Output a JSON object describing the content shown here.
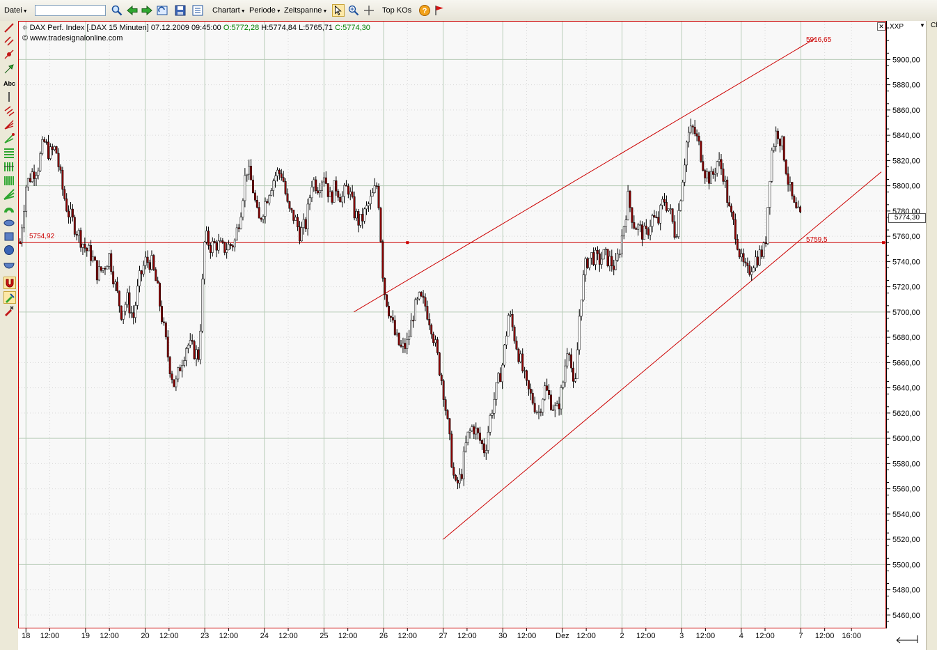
{
  "toolbar": {
    "file_menu": "Datei",
    "symbol_value": "",
    "chart_type_menu": "Chartart",
    "period_menu": "Periode",
    "timespan_menu": "Zeitspanne",
    "top_kos": "Top KOs"
  },
  "chart_header": {
    "title": "DAX Perf. Index [.DAX  15 Minuten]",
    "datetime": "07.12.2009 09:45:00",
    "open": "O:5772,28",
    "high": "H:5774,84",
    "low": "L:5765,71",
    "close": "C:5774,30",
    "copyright": "© www.tradesignalonline.com"
  },
  "axis_header": "XXP",
  "right_strip_label": "Ch",
  "price_labels": {
    "current": "5774,30",
    "hline_left": "5754,92",
    "hline_right": "5759,5",
    "trend_top": "5916,65"
  },
  "colors": {
    "accent": "#cc0000",
    "candle_down": "#8b0000",
    "open_text": "#008000",
    "grid": "#c8d8c8"
  },
  "chart_data": {
    "type": "candlestick",
    "ylim": [
      5450,
      5930
    ],
    "y_ticks": [
      5460,
      5480,
      5500,
      5520,
      5540,
      5560,
      5580,
      5600,
      5620,
      5640,
      5660,
      5680,
      5700,
      5720,
      5740,
      5760,
      5780,
      5800,
      5820,
      5840,
      5860,
      5880,
      5900
    ],
    "y_tick_labels": [
      "5460,00",
      "5480,00",
      "5500,00",
      "5520,00",
      "5540,00",
      "5560,00",
      "5580,00",
      "5600,00",
      "5620,00",
      "5640,00",
      "5660,00",
      "5680,00",
      "5700,00",
      "5720,00",
      "5740,00",
      "5760,00",
      "5780,00",
      "5800,00",
      "5820,00",
      "5840,00",
      "5860,00",
      "5880,00",
      "5900,00"
    ],
    "x_tick_labels": [
      {
        "label": "18",
        "x": 0
      },
      {
        "label": "12:00",
        "x": 4
      },
      {
        "label": "19",
        "x": 10
      },
      {
        "label": "12:00",
        "x": 14
      },
      {
        "label": "20",
        "x": 20
      },
      {
        "label": "12:00",
        "x": 24
      },
      {
        "label": "23",
        "x": 30
      },
      {
        "label": "12:00",
        "x": 34
      },
      {
        "label": "24",
        "x": 40
      },
      {
        "label": "12:00",
        "x": 44
      },
      {
        "label": "25",
        "x": 50
      },
      {
        "label": "12:00",
        "x": 54
      },
      {
        "label": "26",
        "x": 60
      },
      {
        "label": "12:00",
        "x": 64
      },
      {
        "label": "27",
        "x": 70
      },
      {
        "label": "12:00",
        "x": 74
      },
      {
        "label": "30",
        "x": 80
      },
      {
        "label": "12:00",
        "x": 84
      },
      {
        "label": "Dez",
        "x": 90
      },
      {
        "label": "12:00",
        "x": 94
      },
      {
        "label": "2",
        "x": 100
      },
      {
        "label": "12:00",
        "x": 104
      },
      {
        "label": "3",
        "x": 110
      },
      {
        "label": "12:00",
        "x": 114
      },
      {
        "label": "4",
        "x": 120
      },
      {
        "label": "12:00",
        "x": 124
      },
      {
        "label": "7",
        "x": 130
      },
      {
        "label": "12:00",
        "x": 134
      },
      {
        "label": "16:00",
        "x": 138.5
      }
    ],
    "xlim": [
      -1.2,
      144.2
    ],
    "price_path": [
      [
        -1,
        5755
      ],
      [
        0,
        5800
      ],
      [
        1,
        5810
      ],
      [
        2,
        5815
      ],
      [
        3,
        5835
      ],
      [
        4,
        5825
      ],
      [
        5,
        5830
      ],
      [
        6,
        5800
      ],
      [
        7,
        5780
      ],
      [
        8,
        5770
      ],
      [
        9,
        5760
      ],
      [
        10,
        5750
      ],
      [
        11,
        5745
      ],
      [
        12,
        5730
      ],
      [
        13,
        5735
      ],
      [
        14,
        5745
      ],
      [
        15,
        5720
      ],
      [
        16,
        5700
      ],
      [
        17,
        5710
      ],
      [
        18,
        5695
      ],
      [
        19,
        5725
      ],
      [
        20,
        5740
      ],
      [
        21,
        5740
      ],
      [
        22,
        5720
      ],
      [
        23,
        5690
      ],
      [
        24,
        5660
      ],
      [
        25,
        5640
      ],
      [
        26,
        5660
      ],
      [
        27,
        5675
      ],
      [
        28,
        5670
      ],
      [
        29,
        5665
      ],
      [
        30,
        5760
      ],
      [
        31,
        5752
      ],
      [
        32,
        5754
      ],
      [
        33,
        5750
      ],
      [
        34,
        5752
      ],
      [
        35,
        5755
      ],
      [
        36,
        5780
      ],
      [
        37,
        5815
      ],
      [
        38,
        5800
      ],
      [
        39,
        5770
      ],
      [
        40,
        5785
      ],
      [
        41,
        5800
      ],
      [
        42,
        5810
      ],
      [
        43,
        5810
      ],
      [
        44,
        5780
      ],
      [
        45,
        5775
      ],
      [
        46,
        5762
      ],
      [
        47,
        5770
      ],
      [
        48,
        5805
      ],
      [
        49,
        5800
      ],
      [
        50,
        5810
      ],
      [
        51,
        5790
      ],
      [
        52,
        5800
      ],
      [
        53,
        5790
      ],
      [
        54,
        5800
      ],
      [
        55,
        5780
      ],
      [
        56,
        5770
      ],
      [
        57,
        5780
      ],
      [
        58,
        5790
      ],
      [
        59,
        5802
      ],
      [
        60,
        5720
      ],
      [
        61,
        5700
      ],
      [
        62,
        5680
      ],
      [
        63,
        5670
      ],
      [
        64,
        5675
      ],
      [
        65,
        5700
      ],
      [
        66,
        5710
      ],
      [
        67,
        5705
      ],
      [
        68,
        5690
      ],
      [
        69,
        5665
      ],
      [
        70,
        5640
      ],
      [
        71,
        5600
      ],
      [
        72,
        5560
      ],
      [
        73,
        5570
      ],
      [
        74,
        5600
      ],
      [
        75,
        5610
      ],
      [
        76,
        5600
      ],
      [
        77,
        5590
      ],
      [
        78,
        5620
      ],
      [
        79,
        5640
      ],
      [
        80,
        5660
      ],
      [
        81,
        5700
      ],
      [
        82,
        5680
      ],
      [
        83,
        5660
      ],
      [
        84,
        5640
      ],
      [
        85,
        5630
      ],
      [
        86,
        5620
      ],
      [
        87,
        5640
      ],
      [
        88,
        5630
      ],
      [
        89,
        5620
      ],
      [
        90,
        5640
      ],
      [
        91,
        5680
      ],
      [
        92,
        5630
      ],
      [
        93,
        5710
      ],
      [
        94,
        5740
      ],
      [
        95,
        5745
      ],
      [
        96,
        5740
      ],
      [
        97,
        5745
      ],
      [
        98,
        5740
      ],
      [
        99,
        5735
      ],
      [
        100,
        5760
      ],
      [
        101,
        5790
      ],
      [
        102,
        5770
      ],
      [
        103,
        5765
      ],
      [
        104,
        5760
      ],
      [
        105,
        5775
      ],
      [
        106,
        5770
      ],
      [
        107,
        5790
      ],
      [
        108,
        5780
      ],
      [
        109,
        5760
      ],
      [
        110,
        5800
      ],
      [
        111,
        5840
      ],
      [
        112,
        5845
      ],
      [
        113,
        5830
      ],
      [
        114,
        5810
      ],
      [
        115,
        5805
      ],
      [
        116,
        5820
      ],
      [
        117,
        5810
      ],
      [
        118,
        5780
      ],
      [
        119,
        5765
      ],
      [
        120,
        5740
      ],
      [
        121,
        5730
      ],
      [
        122,
        5740
      ],
      [
        123,
        5745
      ],
      [
        124,
        5750
      ],
      [
        125,
        5825
      ],
      [
        126,
        5845
      ],
      [
        127,
        5830
      ],
      [
        128,
        5800
      ],
      [
        129,
        5780
      ],
      [
        130,
        5774
      ]
    ],
    "horizontal_line": 5755,
    "trend_lines": [
      {
        "x1": 55,
        "y1": 5700,
        "x2": 132.4,
        "y2": 5916.65
      },
      {
        "x1": 70,
        "y1": 5520,
        "x2": 143.5,
        "y2": 5811
      }
    ],
    "current_price": 5774.3
  }
}
